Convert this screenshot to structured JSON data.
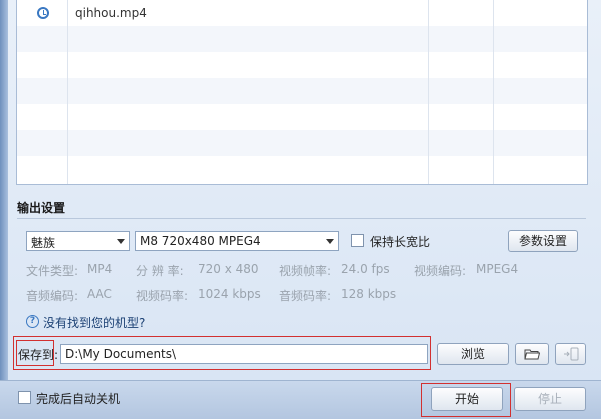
{
  "file_list": {
    "rows": [
      {
        "icon": "clock-icon",
        "name": "qihhou.mp4"
      }
    ]
  },
  "output_settings": {
    "title": "输出设置",
    "brand_select": "魅族",
    "model_select": "M8 720x480 MPEG4",
    "keep_aspect_label": "保持长宽比",
    "param_button": "参数设置",
    "info": {
      "file_type_label": "文件类型:",
      "file_type_value": "MP4",
      "resolution_label": "分 辨 率:",
      "resolution_value": "720 x 480",
      "framerate_label": "视频帧率:",
      "framerate_value": "24.0 fps",
      "video_codec_label": "视频编码:",
      "video_codec_value": "MPEG4",
      "audio_codec_label": "音频编码:",
      "audio_codec_value": "AAC",
      "video_bitrate_label": "视频码率:",
      "video_bitrate_value": "1024 kbps",
      "audio_bitrate_label": "音频码率:",
      "audio_bitrate_value": "128 kbps"
    },
    "help_link": "没有找到您的机型?"
  },
  "save": {
    "label": "保存到:",
    "path": "D:\\My Documents\\",
    "browse_button": "浏览"
  },
  "bottom": {
    "shutdown_label": "完成后自动关机",
    "start_button": "开始",
    "stop_button": "停止"
  }
}
